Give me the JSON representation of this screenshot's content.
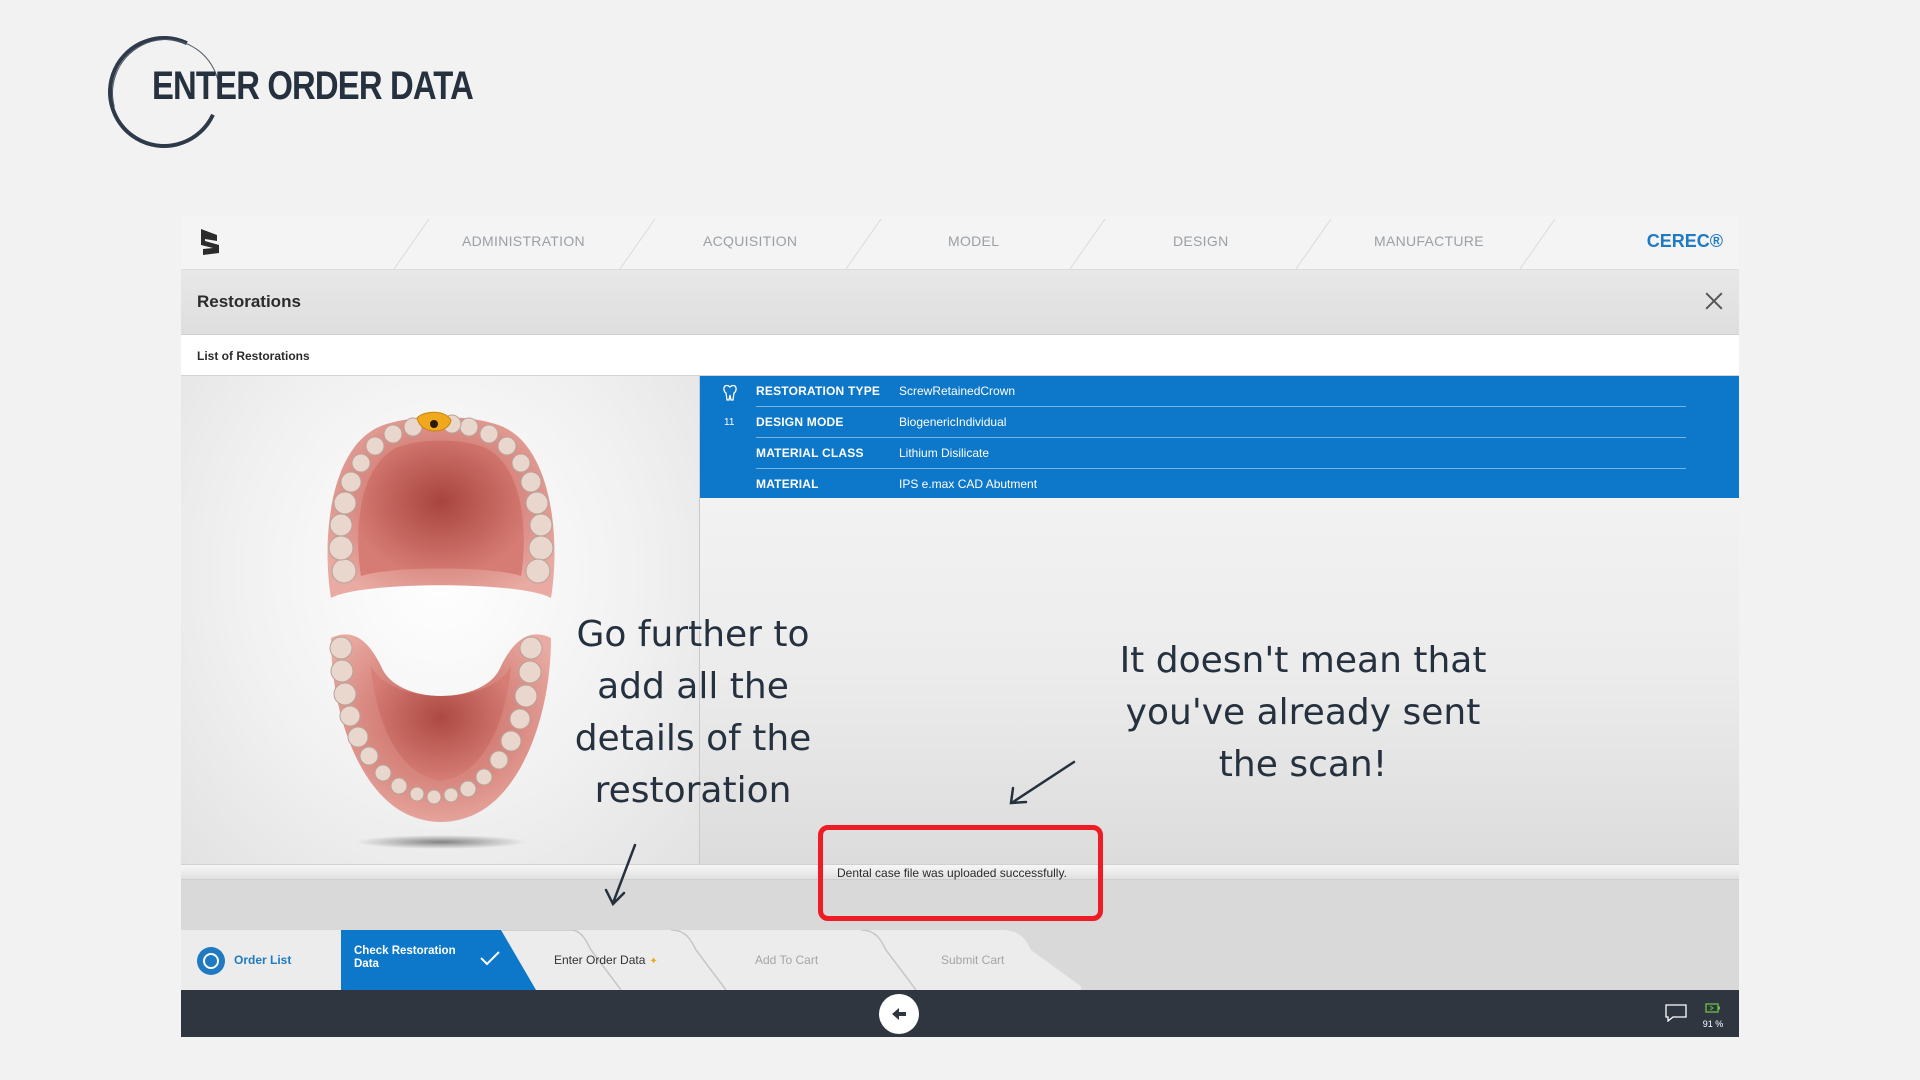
{
  "slide": {
    "title": "ENTER ORDER DATA"
  },
  "nav": {
    "items": [
      "ADMINISTRATION",
      "ACQUISITION",
      "MODEL",
      "DESIGN",
      "MANUFACTURE"
    ],
    "brand": "CEREC®"
  },
  "restorations": {
    "title": "Restorations",
    "list_label": "List of Restorations",
    "tooth_number": "11",
    "rows": [
      {
        "key": "RESTORATION TYPE",
        "value": "ScrewRetainedCrown"
      },
      {
        "key": "DESIGN MODE",
        "value": "BiogenericIndividual"
      },
      {
        "key": "MATERIAL CLASS",
        "value": "Lithium Disilicate"
      },
      {
        "key": "MATERIAL",
        "value": "IPS e.max CAD Abutment"
      }
    ]
  },
  "annotations": {
    "left": [
      "Go further to",
      "add all the",
      "details of the",
      "restoration"
    ],
    "right": [
      "It doesn't mean that",
      "you've already sent",
      "the scan!"
    ]
  },
  "notice": "Dental case file was uploaded successfully.",
  "workflow": {
    "order_list": "Order List",
    "check_restoration_line1": "Check Restoration",
    "check_restoration_line2": "Data",
    "enter_order": "Enter Order Data",
    "add_to_cart": "Add To Cart",
    "submit_cart": "Submit Cart"
  },
  "status": {
    "battery": "91 %"
  },
  "colors": {
    "accent": "#0d77c9",
    "highlight": "#ee1c24",
    "annotation": "#26313f"
  }
}
